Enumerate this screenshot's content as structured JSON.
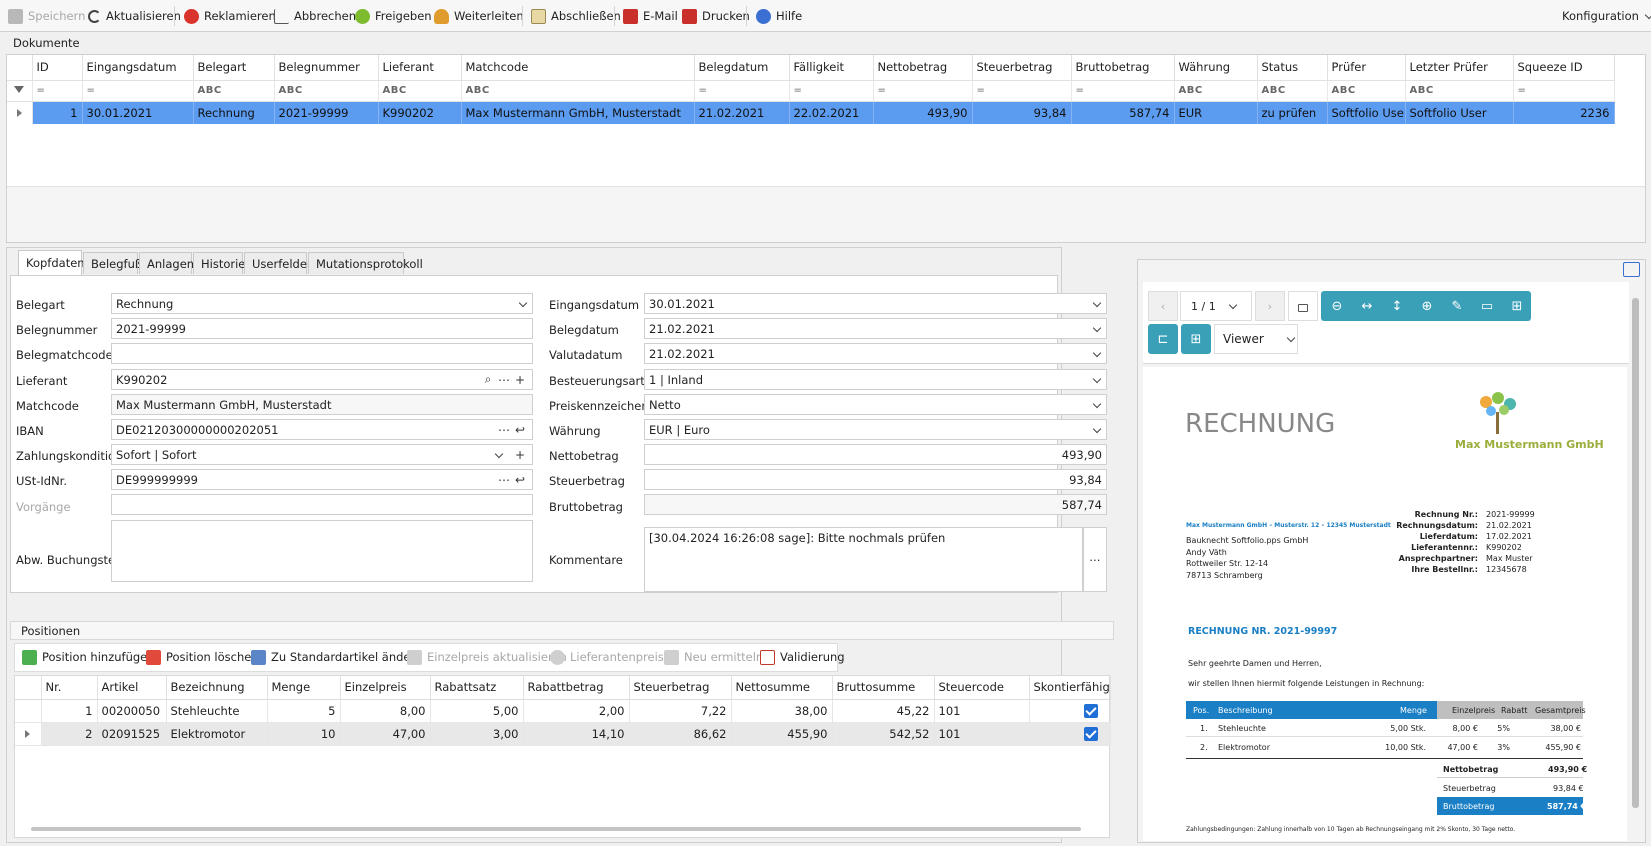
{
  "toolbar": {
    "save": "Speichern",
    "refresh": "Aktualisieren",
    "complain": "Reklamieren",
    "abort": "Abbrechen",
    "release": "Freigeben",
    "forward": "Weiterleiten",
    "close": "Abschließen",
    "email": "E-Mail",
    "print": "Drucken",
    "help": "Hilfe",
    "config": "Konfiguration"
  },
  "documents": {
    "title": "Dokumente",
    "columns": [
      "ID",
      "Eingangsdatum",
      "Belegart",
      "Belegnummer",
      "Lieferant",
      "Matchcode",
      "Belegdatum",
      "Fälligkeit",
      "Nettobetrag",
      "Steuerbetrag",
      "Bruttobetrag",
      "Währung",
      "Status",
      "Prüfer",
      "Letzter Prüfer",
      "Squeeze ID"
    ],
    "filter_eq": "=",
    "filter_abc": "ABC",
    "row": [
      "1",
      "30.01.2021",
      "Rechnung",
      "2021-99999",
      "K990202",
      "Max Mustermann GmbH, Musterstadt",
      "21.02.2021",
      "22.02.2021",
      "493,90",
      "93,84",
      "587,74",
      "EUR",
      "zu prüfen",
      "Softfolio User",
      "Softfolio User",
      "2236"
    ]
  },
  "tabs": [
    "Kopfdaten",
    "Belegfuß",
    "Anlagen",
    "Historie",
    "Userfelder",
    "Mutationsprotokoll"
  ],
  "form": {
    "belegart_label": "Belegart",
    "belegart": "Rechnung",
    "belegnummer_label": "Belegnummer",
    "belegnummer": "2021-99999",
    "belegmatchcode_label": "Belegmatchcode",
    "belegmatchcode": "",
    "lieferant_label": "Lieferant",
    "lieferant": "K990202",
    "matchcode_label": "Matchcode",
    "matchcode": "Max Mustermann GmbH, Musterstadt",
    "iban_label": "IBAN",
    "iban": "DE02120300000000202051",
    "zahlungskondition_label": "Zahlungskondition",
    "zahlungskondition": "Sofort | Sofort",
    "ustid_label": "USt-IdNr.",
    "ustid": "DE999999999",
    "vorgaenge_label": "Vorgänge",
    "vorgaenge": "",
    "buchungstext_label": "Abw. Buchungstext",
    "buchungstext": "",
    "eingangsdatum_label": "Eingangsdatum",
    "eingangsdatum": "30.01.2021",
    "belegdatum_label": "Belegdatum",
    "belegdatum": "21.02.2021",
    "valutadatum_label": "Valutadatum",
    "valutadatum": "21.02.2021",
    "besteuerungsart_label": "Besteuerungsart",
    "besteuerungsart": "1 | Inland",
    "preiskennzeichen_label": "Preiskennzeichen",
    "preiskennzeichen": "Netto",
    "waehrung_label": "Währung",
    "waehrung": "EUR | Euro",
    "nettobetrag_label": "Nettobetrag",
    "nettobetrag": "493,90",
    "steuerbetrag_label": "Steuerbetrag",
    "steuerbetrag": "93,84",
    "bruttobetrag_label": "Bruttobetrag",
    "bruttobetrag": "587,74",
    "kommentare_label": "Kommentare",
    "kommentare": "[30.04.2024 16:26:08 sage]: Bitte nochmals prüfen"
  },
  "positions": {
    "title": "Positionen",
    "toolbar": {
      "add": "Position hinzufügen",
      "delete": "Position löschen",
      "standard": "Zu Standardartikel ändern",
      "update_price": "Einzelpreis aktualisieren",
      "supplier_prices": "Lieferantenpreise",
      "recalc": "Neu ermitteln",
      "validate": "Validierung"
    },
    "columns": [
      "Nr.",
      "Artikel",
      "Bezeichnung",
      "Menge",
      "Einzelpreis",
      "Rabattsatz",
      "Rabattbetrag",
      "Steuerbetrag",
      "Nettosumme",
      "Bruttosumme",
      "Steuercode",
      "Skontierfähig"
    ],
    "rows": [
      [
        "1",
        "00200050",
        "Stehleuchte",
        "5",
        "8,00",
        "5,00",
        "2,00",
        "7,22",
        "38,00",
        "45,22",
        "101"
      ],
      [
        "2",
        "02091525",
        "Elektromotor",
        "10",
        "47,00",
        "3,00",
        "14,10",
        "86,62",
        "455,90",
        "542,52",
        "101"
      ]
    ]
  },
  "viewer": {
    "page": "1 / 1",
    "mode": "Viewer",
    "invoice": {
      "title": "RECHNUNG",
      "company": "Max Mustermann GmbH",
      "sender_line": "Max Mustermann GmbH – Musterstr. 12 – 12345 Musterstadt",
      "recipient": [
        "Bauknecht Softfolio.pps GmbH",
        "Andy Väth",
        "Rottweiler Str. 12-14",
        "78713 Schramberg"
      ],
      "meta_labels": [
        "Rechnung Nr.:",
        "Rechnungsdatum:",
        "Lieferdatum:",
        "Lieferantennr.:",
        "Ansprechpartner:",
        "Ihre Bestellnr.:"
      ],
      "meta_values": [
        "2021-99999",
        "21.02.2021",
        "17.02.2021",
        "K990202",
        "Max Muster",
        "12345678"
      ],
      "heading": "RECHNUNG NR. 2021-99997",
      "greeting": "Sehr geehrte Damen und Herren,",
      "intro": "wir stellen Ihnen hiermit folgende Leistungen in Rechnung:",
      "table_head": [
        "Pos.",
        "Beschreibung",
        "Menge",
        "Einzelpreis",
        "Rabatt",
        "Gesamtpreis"
      ],
      "rows": [
        [
          "1.",
          "Stehleuchte",
          "5,00 Stk.",
          "8,00 €",
          "5%",
          "38,00 €"
        ],
        [
          "2.",
          "Elektromotor",
          "10,00 Stk.",
          "47,00 €",
          "3%",
          "455,90 €"
        ]
      ],
      "net_label": "Nettobetrag",
      "net": "493,90 €",
      "tax_label": "Steuerbetrag",
      "tax": "93,84 €",
      "gross_label": "Bruttobetrag",
      "gross": "587,74 €",
      "footer": "Zahlungsbedingungen: Zahlung innerhalb von 10 Tagen ab Rechnungseingang mit 2% Skonto, 30 Tage netto."
    }
  },
  "colors": {
    "selection": "#5b9bf0",
    "viewer_toolbar": "#3aa0b8",
    "invoice_blue": "#1a7fc4",
    "company_green": "#9bae3c"
  }
}
